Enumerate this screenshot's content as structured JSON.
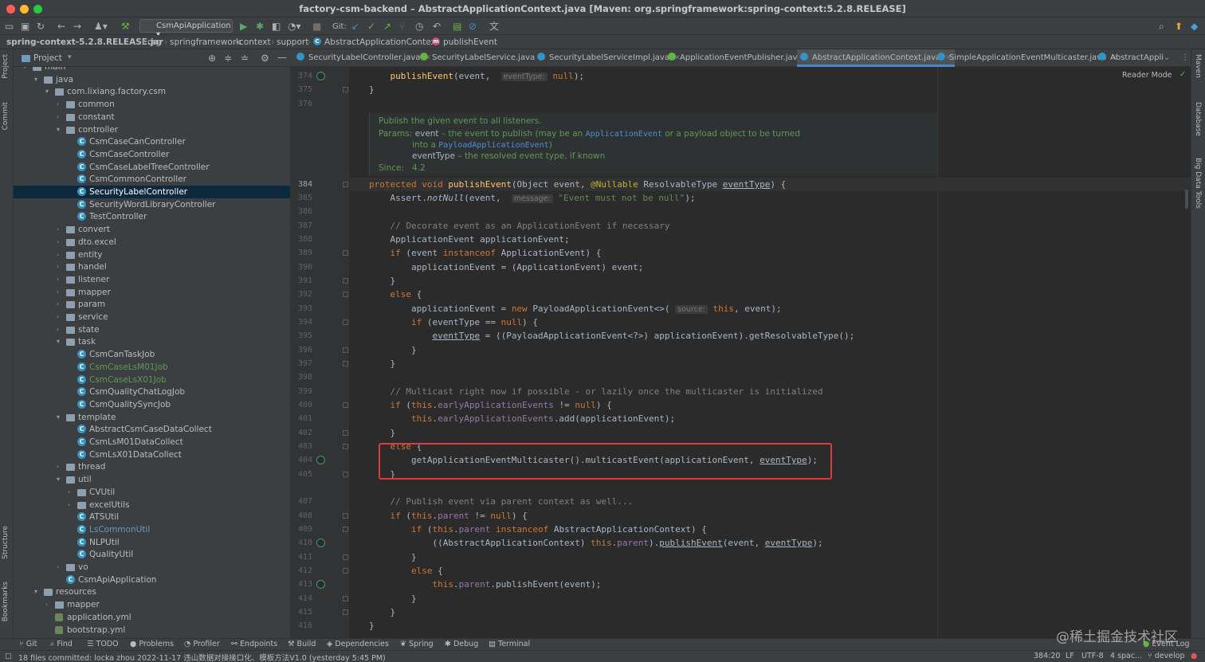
{
  "window": {
    "title": "factory-csm-backend – AbstractApplicationContext.java [Maven: org.springframework:spring-context:5.2.8.RELEASE]"
  },
  "toolbar": {
    "run_config": "CsmApiApplication",
    "git_label": "Git:"
  },
  "breadcrumb": [
    "spring-context-5.2.8.RELEASE.jar",
    "org",
    "springframework",
    "context",
    "support",
    "AbstractApplicationContext",
    "publishEvent"
  ],
  "left_strip": [
    "Project",
    "Commit",
    "Structure",
    "Bookmarks"
  ],
  "right_strip": [
    "Maven",
    "Database",
    "Big Data Tools"
  ],
  "project_panel": {
    "title": "Project",
    "tree": [
      {
        "label": "main",
        "depth": 4,
        "kind": "folder",
        "expanded": true
      },
      {
        "label": "java",
        "depth": 5,
        "kind": "folder",
        "expanded": true
      },
      {
        "label": "com.lixiang.factory.csm",
        "depth": 6,
        "kind": "folder",
        "expanded": true
      },
      {
        "label": "common",
        "depth": 7,
        "kind": "folder",
        "expanded": false
      },
      {
        "label": "constant",
        "depth": 7,
        "kind": "folder",
        "expanded": false
      },
      {
        "label": "controller",
        "depth": 7,
        "kind": "folder",
        "expanded": true
      },
      {
        "label": "CsmCaseCanController",
        "depth": 8,
        "kind": "class"
      },
      {
        "label": "CsmCaseController",
        "depth": 8,
        "kind": "class"
      },
      {
        "label": "CsmCaseLabelTreeController",
        "depth": 8,
        "kind": "class"
      },
      {
        "label": "CsmCommonController",
        "depth": 8,
        "kind": "class"
      },
      {
        "label": "SecurityLabelController",
        "depth": 8,
        "kind": "class",
        "selected": true
      },
      {
        "label": "SecurityWordLibraryController",
        "depth": 8,
        "kind": "class"
      },
      {
        "label": "TestController",
        "depth": 8,
        "kind": "class"
      },
      {
        "label": "convert",
        "depth": 7,
        "kind": "folder",
        "expanded": false
      },
      {
        "label": "dto.excel",
        "depth": 7,
        "kind": "folder",
        "expanded": false
      },
      {
        "label": "entity",
        "depth": 7,
        "kind": "folder",
        "expanded": false
      },
      {
        "label": "handel",
        "depth": 7,
        "kind": "folder",
        "expanded": false
      },
      {
        "label": "listener",
        "depth": 7,
        "kind": "folder",
        "expanded": false
      },
      {
        "label": "mapper",
        "depth": 7,
        "kind": "folder",
        "expanded": false
      },
      {
        "label": "param",
        "depth": 7,
        "kind": "folder",
        "expanded": false
      },
      {
        "label": "service",
        "depth": 7,
        "kind": "folder",
        "expanded": false
      },
      {
        "label": "state",
        "depth": 7,
        "kind": "folder",
        "expanded": false
      },
      {
        "label": "task",
        "depth": 7,
        "kind": "folder",
        "expanded": true
      },
      {
        "label": "CsmCanTaskJob",
        "depth": 8,
        "kind": "class"
      },
      {
        "label": "CsmCaseLsM01Job",
        "depth": 8,
        "kind": "class",
        "modified": true
      },
      {
        "label": "CsmCaseLsX01Job",
        "depth": 8,
        "kind": "class",
        "modified": true
      },
      {
        "label": "CsmQualityChatLogJob",
        "depth": 8,
        "kind": "class"
      },
      {
        "label": "CsmQualitySyncJob",
        "depth": 8,
        "kind": "class"
      },
      {
        "label": "template",
        "depth": 7,
        "kind": "folder",
        "expanded": true
      },
      {
        "label": "AbstractCsmCaseDataCollect",
        "depth": 8,
        "kind": "class"
      },
      {
        "label": "CsmLsM01DataCollect",
        "depth": 8,
        "kind": "class"
      },
      {
        "label": "CsmLsX01DataCollect",
        "depth": 8,
        "kind": "class"
      },
      {
        "label": "thread",
        "depth": 7,
        "kind": "folder",
        "expanded": false
      },
      {
        "label": "util",
        "depth": 7,
        "kind": "folder",
        "expanded": true
      },
      {
        "label": "CVUtil",
        "depth": 8,
        "kind": "folder",
        "expanded": false
      },
      {
        "label": "excelUtils",
        "depth": 8,
        "kind": "folder",
        "expanded": false
      },
      {
        "label": "ATSUtil",
        "depth": 8,
        "kind": "class"
      },
      {
        "label": "LsCommonUtil",
        "depth": 8,
        "kind": "class",
        "modified_blue": true
      },
      {
        "label": "NLPUtil",
        "depth": 8,
        "kind": "class"
      },
      {
        "label": "QualityUtil",
        "depth": 8,
        "kind": "class"
      },
      {
        "label": "vo",
        "depth": 7,
        "kind": "folder",
        "expanded": false
      },
      {
        "label": "CsmApiApplication",
        "depth": 7,
        "kind": "class"
      },
      {
        "label": "resources",
        "depth": 5,
        "kind": "folder",
        "expanded": true
      },
      {
        "label": "mapper",
        "depth": 6,
        "kind": "folder",
        "expanded": false
      },
      {
        "label": "application.yml",
        "depth": 6,
        "kind": "file"
      },
      {
        "label": "bootstrap.yml",
        "depth": 6,
        "kind": "file"
      }
    ]
  },
  "tabs": [
    {
      "label": "SecurityLabelController.java",
      "color": "#3592c4"
    },
    {
      "label": "SecurityLabelService.java",
      "color": "#62b543"
    },
    {
      "label": "SecurityLabelServiceImpl.java",
      "color": "#3592c4"
    },
    {
      "label": "ApplicationEventPublisher.java",
      "color": "#62b543"
    },
    {
      "label": "AbstractApplicationContext.java",
      "color": "#3592c4",
      "active": true
    },
    {
      "label": "SimpleApplicationEventMulticaster.java",
      "color": "#3592c4"
    },
    {
      "label": "AbstractAppli",
      "color": "#3592c4"
    }
  ],
  "editor": {
    "reader_mode": "Reader Mode",
    "doc": {
      "summary": "Publish the given event to all listeners.",
      "params_label": "Params:",
      "p1_name": "event",
      "p1_a": " – the event to publish (may be an ",
      "p1_link1": "ApplicationEvent",
      "p1_b": " or a payload object to be turned",
      "p1_c": "into a ",
      "p1_link2": "PayloadApplicationEvent",
      "p1_d": ")",
      "p2_name": "eventType",
      "p2_a": " – the resolved event type, if known",
      "since_label": "Since:",
      "since_value": "4.2"
    },
    "line_numbers": {
      "l374": "374",
      "l375": "375",
      "l376": "376",
      "l384": "384",
      "l385": "385",
      "l386": "386",
      "l387": "387",
      "l388": "388",
      "l389": "389",
      "l390": "390",
      "l391": "391",
      "l392": "392",
      "l393": "393",
      "l394": "394",
      "l395": "395",
      "l396": "396",
      "l397": "397",
      "l398": "398",
      "l399": "399",
      "l400": "400",
      "l401": "401",
      "l402": "402",
      "l403": "403",
      "l404": "404",
      "l405": "405",
      "l407": "407",
      "l408": "408",
      "l409": "409",
      "l410": "410",
      "l411": "411",
      "l412": "412",
      "l413": "413",
      "l414": "414",
      "l415": "415",
      "l416": "416"
    }
  },
  "bottom_tools": [
    "Git",
    "Find",
    "TODO",
    "Problems",
    "Profiler",
    "Endpoints",
    "Build",
    "Dependencies",
    "Spring",
    "Debug",
    "Terminal",
    "Event Log"
  ],
  "status": {
    "message": "18 files committed: locka zhou 2022-11-17 违山数据对接接口化、模板方法V1.0 (yesterday 5:45 PM)",
    "position": "384:20",
    "line_sep": "LF",
    "encoding": "UTF-8",
    "indent": "4 spac...",
    "branch": "develop"
  },
  "watermark": "@稀土掘金技术社区",
  "icons": [
    "folder-icon",
    "class-icon",
    "run-icon",
    "debug-icon",
    "git-update-icon",
    "git-commit-icon",
    "search-icon",
    "bulb-icon"
  ]
}
